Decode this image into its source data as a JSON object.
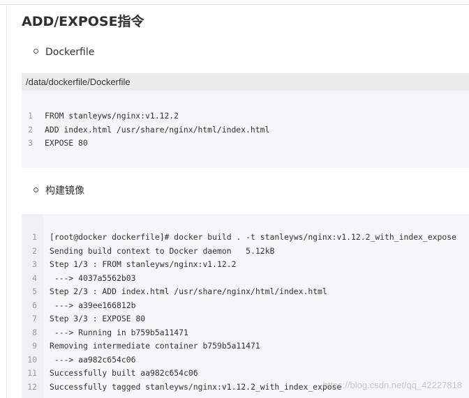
{
  "title": "ADD/EXPOSE指令",
  "bullets": [
    "Dockerfile",
    "构建镜像"
  ],
  "dockerfile": {
    "path": "/data/dockerfile/Dockerfile",
    "lines": [
      {
        "n": "1",
        "text": "FROM stanleyws/nginx:v1.12.2"
      },
      {
        "n": "2",
        "text": "ADD index.html /usr/share/nginx/html/index.html"
      },
      {
        "n": "3",
        "text": "EXPOSE 80"
      }
    ]
  },
  "build": {
    "lines": [
      {
        "n": "1",
        "text": "[root@docker dockerfile]# docker build . -t stanleyws/nginx:v1.12.2_with_index_expose"
      },
      {
        "n": "2",
        "text": "Sending build context to Docker daemon   5.12kB"
      },
      {
        "n": "3",
        "text": "Step 1/3 : FROM stanleyws/nginx:v1.12.2"
      },
      {
        "n": "4",
        "text": " ---> 4037a5562b03"
      },
      {
        "n": "5",
        "text": "Step 2/3 : ADD index.html /usr/share/nginx/html/index.html"
      },
      {
        "n": "6",
        "text": " ---> a39ee166812b"
      },
      {
        "n": "7",
        "text": "Step 3/3 : EXPOSE 80"
      },
      {
        "n": "8",
        "text": " ---> Running in b759b5a11471"
      },
      {
        "n": "9",
        "text": "Removing intermediate container b759b5a11471"
      },
      {
        "n": "10",
        "text": " ---> aa982c654c06"
      },
      {
        "n": "11",
        "text": "Successfully built aa982c654c06"
      },
      {
        "n": "12",
        "text": "Successfully tagged stanleyws/nginx:v1.12.2_with_index_expose"
      }
    ]
  },
  "watermark": "https://blog.csdn.net/qq_42227818"
}
